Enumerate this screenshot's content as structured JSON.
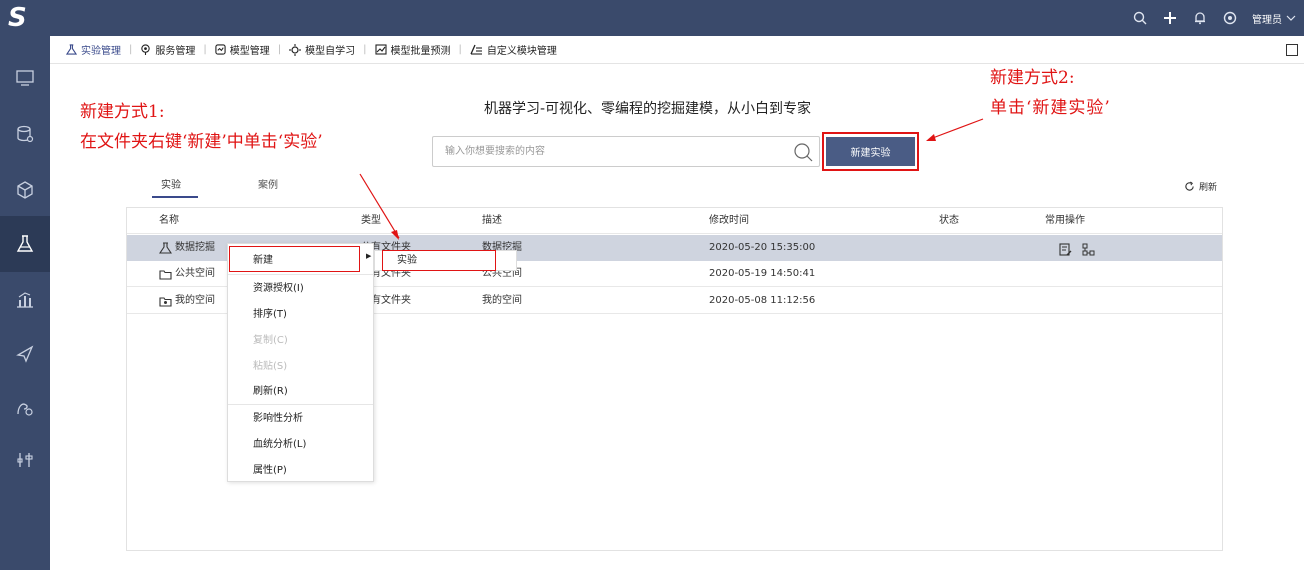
{
  "header": {
    "logo": "S",
    "admin_label": "管理员"
  },
  "nav": {
    "items": [
      {
        "label": "实验管理",
        "icon": "flask-icon"
      },
      {
        "label": "服务管理",
        "icon": "service-icon"
      },
      {
        "label": "模型管理",
        "icon": "model-icon"
      },
      {
        "label": "模型自学习",
        "icon": "bulb-icon"
      },
      {
        "label": "模型批量预测",
        "icon": "chart-icon"
      },
      {
        "label": "自定义模块管理",
        "icon": "custom-icon"
      }
    ]
  },
  "annotations": {
    "left_line1": "新建方式1:",
    "left_line2": "在文件夹右键‘新建’中单击‘实验’",
    "right_line1": "新建方式2:",
    "right_line2": "单击‘新建实验’"
  },
  "main": {
    "tagline": "机器学习-可视化、零编程的挖掘建模，从小白到专家",
    "search_placeholder": "输入你想要搜索的内容",
    "new_button": "新建实验",
    "tabs": [
      "实验",
      "案例"
    ],
    "refresh_label": "刷新"
  },
  "table": {
    "columns": [
      "名称",
      "类型",
      "描述",
      "修改时间",
      "状态",
      "常用操作"
    ],
    "rows": [
      {
        "name": "数据挖掘",
        "type": "公有文件夹",
        "desc": "数据挖掘",
        "time": "2020-05-20 15:35:00",
        "selected": true
      },
      {
        "name": "公共空间",
        "type": "公有文件夹",
        "desc": "公共空间",
        "time": "2020-05-19 14:50:41",
        "selected": false
      },
      {
        "name": "我的空间",
        "type": "私有文件夹",
        "desc": "我的空间",
        "time": "2020-05-08 11:12:56",
        "selected": false
      }
    ]
  },
  "context_menu": {
    "items": [
      {
        "label": "新建",
        "disabled": false
      },
      {
        "label": "资源授权(I)",
        "disabled": false
      },
      {
        "label": "排序(T)",
        "disabled": false
      },
      {
        "label": "复制(C)",
        "disabled": true
      },
      {
        "label": "粘贴(S)",
        "disabled": true
      },
      {
        "label": "刷新(R)",
        "disabled": false
      },
      {
        "label": "影响性分析",
        "disabled": false
      },
      {
        "label": "血统分析(L)",
        "disabled": false
      },
      {
        "label": "属性(P)",
        "disabled": false
      }
    ],
    "submenu_item": "实验"
  },
  "colors": {
    "sidebar_bg": "#3a4a6b",
    "accent": "#4a5c85",
    "annotation_red": "#e01414",
    "selected_row": "#cfd4df"
  }
}
